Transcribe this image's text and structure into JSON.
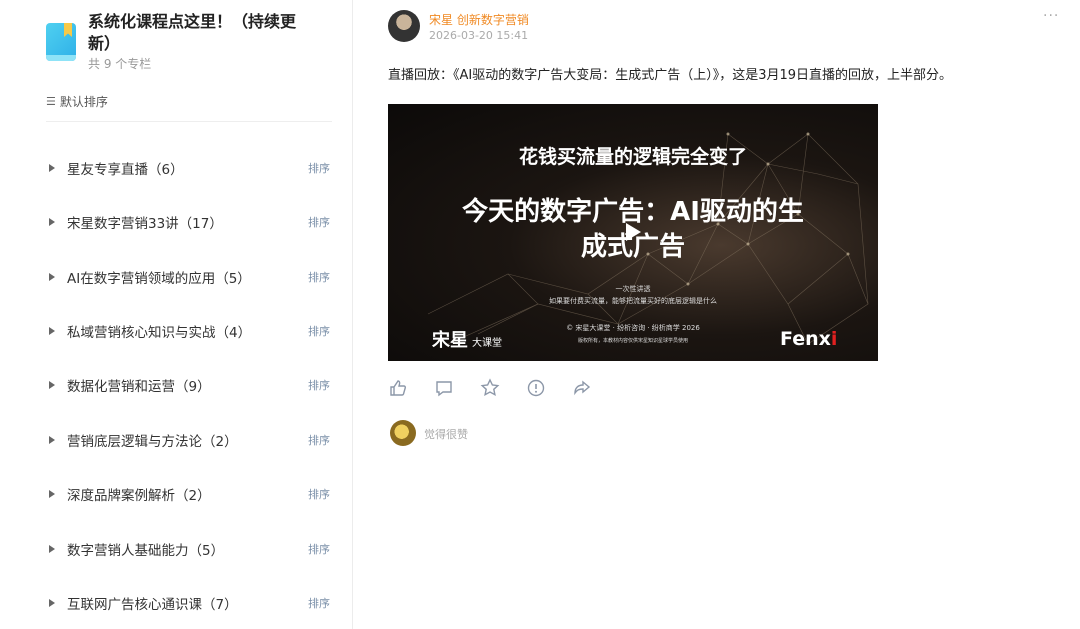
{
  "sidebar": {
    "title": "系统化课程点这里！（持续更新）",
    "count": "共 9 个专栏",
    "sort_default": "默认排序",
    "sort_icon": "sort-lines-icon",
    "items": [
      {
        "label": "星友专享直播（6）",
        "sort": "排序"
      },
      {
        "label": "宋星数字营销33讲（17）",
        "sort": "排序"
      },
      {
        "label": "AI在数字营销领域的应用（5）",
        "sort": "排序"
      },
      {
        "label": "私域营销核心知识与实战（4）",
        "sort": "排序"
      },
      {
        "label": "数据化营销和运营（9）",
        "sort": "排序"
      },
      {
        "label": "营销底层逻辑与方法论（2）",
        "sort": "排序"
      },
      {
        "label": "深度品牌案例解析（2）",
        "sort": "排序"
      },
      {
        "label": "数字营销人基础能力（5）",
        "sort": "排序"
      },
      {
        "label": "互联网广告核心通识课（7）",
        "sort": "排序"
      }
    ]
  },
  "post": {
    "author": "宋星 创新数字营销",
    "date": "2026-03-20 15:41",
    "more": "···",
    "text": "直播回放：《AI驱动的数字广告大变局：生成式广告（上）》，这是3月19日直播的回放，上半部分。",
    "video": {
      "headline": "花钱买流量的逻辑完全变了",
      "title_line1": "今天的数字广告：AI驱动的生",
      "title_line2": "成式广告",
      "sub1": "一次性讲透",
      "sub2": "如果要付费买流量，能够把流量买好的底层逻辑是什么",
      "copyright": "© 宋星大课堂 · 纷析咨询 · 纷析商学 2026",
      "notice": "版权所有，本教材内容仅供宋星知识星球学员使用",
      "logo_left": "宋星",
      "logo_left_sub": "大课堂",
      "logo_right": "Fenx",
      "logo_right_accent": "i"
    },
    "actions": [
      "like-icon",
      "comment-icon",
      "favorite-icon",
      "report-icon",
      "share-icon"
    ],
    "like_text": "觉得很赞"
  },
  "colors": {
    "accent": "#f08a24",
    "sort_link": "#7a8fa8",
    "brand_red": "#e02020"
  }
}
